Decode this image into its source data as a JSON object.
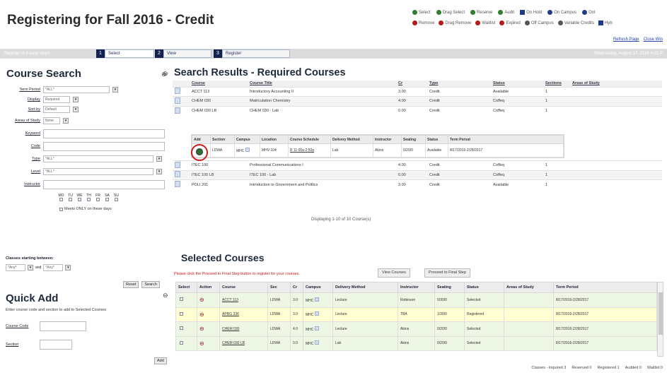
{
  "header": {
    "title": "Registering for Fall 2016 - Credit"
  },
  "legend": {
    "row1": [
      {
        "label": "Select",
        "color": "#2e7d32"
      },
      {
        "label": "Drag Select",
        "color": "#2e7d32"
      },
      {
        "label": "Reserve",
        "color": "#2e7d32"
      },
      {
        "label": "Audit",
        "color": "#2e7d32"
      },
      {
        "label": "On Hold",
        "color": "#1e3a8a"
      },
      {
        "label": "On Campus",
        "color": "#1e3a8a"
      },
      {
        "label": "Onl",
        "color": "#1e3a8a"
      }
    ],
    "row2": [
      {
        "label": "Remove",
        "color": "#b71c1c"
      },
      {
        "label": "Drag Remove",
        "color": "#b71c1c"
      },
      {
        "label": "Waitlist",
        "color": "#b71c1c"
      },
      {
        "label": "Expired",
        "color": "#b71c1c"
      },
      {
        "label": "Off Campus",
        "color": "#555"
      },
      {
        "label": "Variable Credits",
        "color": "#555"
      },
      {
        "label": "Hyb",
        "color": "#1e3a8a"
      }
    ]
  },
  "toplinks": {
    "refresh": "Refresh Page",
    "close": "Close Win"
  },
  "steps": {
    "pre": "Register in 3 easy steps",
    "items": [
      {
        "num": "1",
        "label": "Select"
      },
      {
        "num": "2",
        "label": "View"
      },
      {
        "num": "3",
        "label": "Register"
      }
    ],
    "date": "Wednesday, August 17, 2016 4:01 P"
  },
  "search": {
    "title": "Course Search",
    "fields": [
      {
        "label": "Term Period",
        "value": "*ALL*"
      },
      {
        "label": "Display",
        "value": "Required"
      },
      {
        "label": "Sort by",
        "value": "Default"
      },
      {
        "label": "Areas of Study",
        "value": "None"
      },
      {
        "label": "Keyword",
        "value": ""
      },
      {
        "label": "Code",
        "value": ""
      },
      {
        "label": "Type",
        "value": "*ALL*"
      },
      {
        "label": "Level",
        "value": "*ALL*"
      },
      {
        "label": "Instructor",
        "value": ""
      }
    ],
    "days": [
      "MO",
      "TU",
      "WE",
      "TH",
      "FR",
      "SA",
      "SU"
    ],
    "meets_only": "Meets ONLY on these days",
    "between_label": "Classes starting between:",
    "from": "*Any*",
    "and": "and",
    "to": "*Any*",
    "reset": "Reset",
    "search": "Search"
  },
  "quickadd": {
    "title": "Quick Add",
    "desc": "Enter course code and section to add to Selected Courses",
    "code_label": "Course Code",
    "section_label": "Section",
    "add": "Add"
  },
  "results": {
    "title": "Search Results - Required Courses",
    "headers": [
      "Course",
      "Course Title",
      "Cr",
      "Type",
      "Status",
      "Sections",
      "Areas of Study"
    ],
    "rows": [
      {
        "course": "ACCT 113",
        "title": "Introductory Accounting II",
        "cr": "3.00",
        "type": "Credit",
        "status": "Available",
        "sections": "1"
      },
      {
        "course": "CHEM 030",
        "title": "Matriculation Chemistry",
        "cr": "4.00",
        "type": "Credit",
        "status": "Coffeq",
        "sections": "1"
      },
      {
        "course": "CHEM 030 LB",
        "title": "CHEM 030 - Lab",
        "cr": "0.00",
        "type": "Credit",
        "status": "Coffeq",
        "sections": "1"
      }
    ],
    "rows2": [
      {
        "course": "ITEC 100",
        "title": "Professional Communications I",
        "cr": "4.00",
        "type": "Credit",
        "status": "Coffeq",
        "sections": "1"
      },
      {
        "course": "ITEC 100 LB",
        "title": "ITEC 100 - Lab",
        "cr": "0.00",
        "type": "Credit",
        "status": "Coffeq",
        "sections": "1"
      },
      {
        "course": "POLI 201",
        "title": "Introduction to Government and Politics",
        "cr": "3.00",
        "type": "Credit",
        "status": "Available",
        "sections": "1"
      }
    ],
    "displaying": "Displaying 1-10 of 10 Course(s)"
  },
  "section_table": {
    "headers": [
      "Add",
      "Section",
      "Campus",
      "Location",
      "Course Schedule",
      "Delivery Method",
      "Instructor",
      "Seating",
      "Status",
      "Term Period"
    ],
    "row": {
      "section": "LDWA",
      "campus": "MHC",
      "location": "MHV-104",
      "schedule": "R 11:00a-2:50p",
      "delivery": "Lab",
      "instructor": "Akins",
      "seating": "0/20/0",
      "status": "Available",
      "term": "8/17/2016-2/28/2017"
    }
  },
  "selected": {
    "title": "Selected Courses",
    "notice": "Please click the Proceed to Final Step button to register for your courses.",
    "view_btn": "View Courses",
    "proceed_btn": "Proceed to Final Step",
    "headers": [
      "Select",
      "Action",
      "Course",
      "Sec",
      "Cr",
      "Campus",
      "Delivery Method",
      "Instructor",
      "Seating",
      "Status",
      "Areas of Study",
      "Term Period"
    ],
    "rows": [
      {
        "course": "ACCT 113",
        "sec": "LDWA",
        "cr": "3.0",
        "campus": "MHC",
        "delivery": "Lecture",
        "instructor": "Robinson",
        "seating": "0/30/0",
        "status": "Selected",
        "areas": "",
        "term": "8/17/2016-2/28/2017",
        "yellow": false
      },
      {
        "course": "APRG 336",
        "sec": "LDWA",
        "cr": "3.0",
        "campus": "MHC",
        "delivery": "Lecture",
        "instructor": "TBA",
        "seating": "1/30/0",
        "status": "Registered",
        "areas": "",
        "term": "8/17/2016-2/28/2017",
        "yellow": true
      },
      {
        "course": "CHEM 030",
        "sec": "LDWA",
        "cr": "4.0",
        "campus": "MHC",
        "delivery": "Lecture",
        "instructor": "Akins",
        "seating": "0/20/0",
        "status": "Selected",
        "areas": "",
        "term": "8/17/2016-2/28/2017",
        "yellow": false
      },
      {
        "course": "CHEM 030 LB",
        "sec": "LDWA",
        "cr": "0.0",
        "campus": "MHC",
        "delivery": "Lab",
        "instructor": "Akins",
        "seating": "0/20/0",
        "status": "Selected",
        "areas": "",
        "term": "8/17/2016-2/28/2017",
        "yellow": false
      }
    ]
  },
  "statusbar": [
    "Classes - Inquired 3",
    "Reserved 0",
    "Registered 1",
    "Audited 0",
    "Waitlist 0"
  ]
}
